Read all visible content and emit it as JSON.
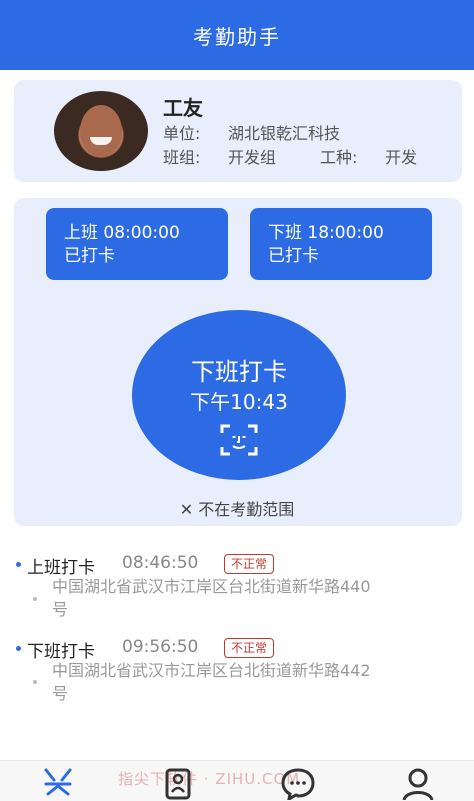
{
  "header": {
    "title": "考勤助手"
  },
  "profile": {
    "name": "工友",
    "unit_label": "单位:",
    "unit_value": "湖北银乾汇科技",
    "group_label": "班组:",
    "group_value": "开发组",
    "worktype_label": "工种:",
    "worktype_value": "开发"
  },
  "shifts": {
    "on": {
      "title": "上班  08:00:00",
      "status": "已打卡"
    },
    "off": {
      "title": "下班  18:00:00",
      "status": "已打卡"
    }
  },
  "punch": {
    "label": "下班打卡",
    "time": "下午10:43",
    "range_text": "✕ 不在考勤范围"
  },
  "records": [
    {
      "title": "上班打卡",
      "time": "08:46:50",
      "badge": "不正常",
      "address_line1": "中国湖北省武汉市江岸区台北街道新华路440",
      "address_line2": "号"
    },
    {
      "title": "下班打卡",
      "time": "09:56:50",
      "badge": "不正常",
      "address_line1": "中国湖北省武汉市江岸区台北街道新华路442",
      "address_line2": "号"
    }
  ],
  "watermark": "指尖下软件 · ZIHU.COM",
  "colors": {
    "primary": "#2d6be4",
    "panel": "#e8eefb",
    "warning": "#c0392b"
  },
  "icons": {
    "tab1": "attendance-icon",
    "tab2": "contacts-icon",
    "tab3": "message-icon",
    "tab4": "user-icon",
    "punch": "face-scan-icon"
  }
}
